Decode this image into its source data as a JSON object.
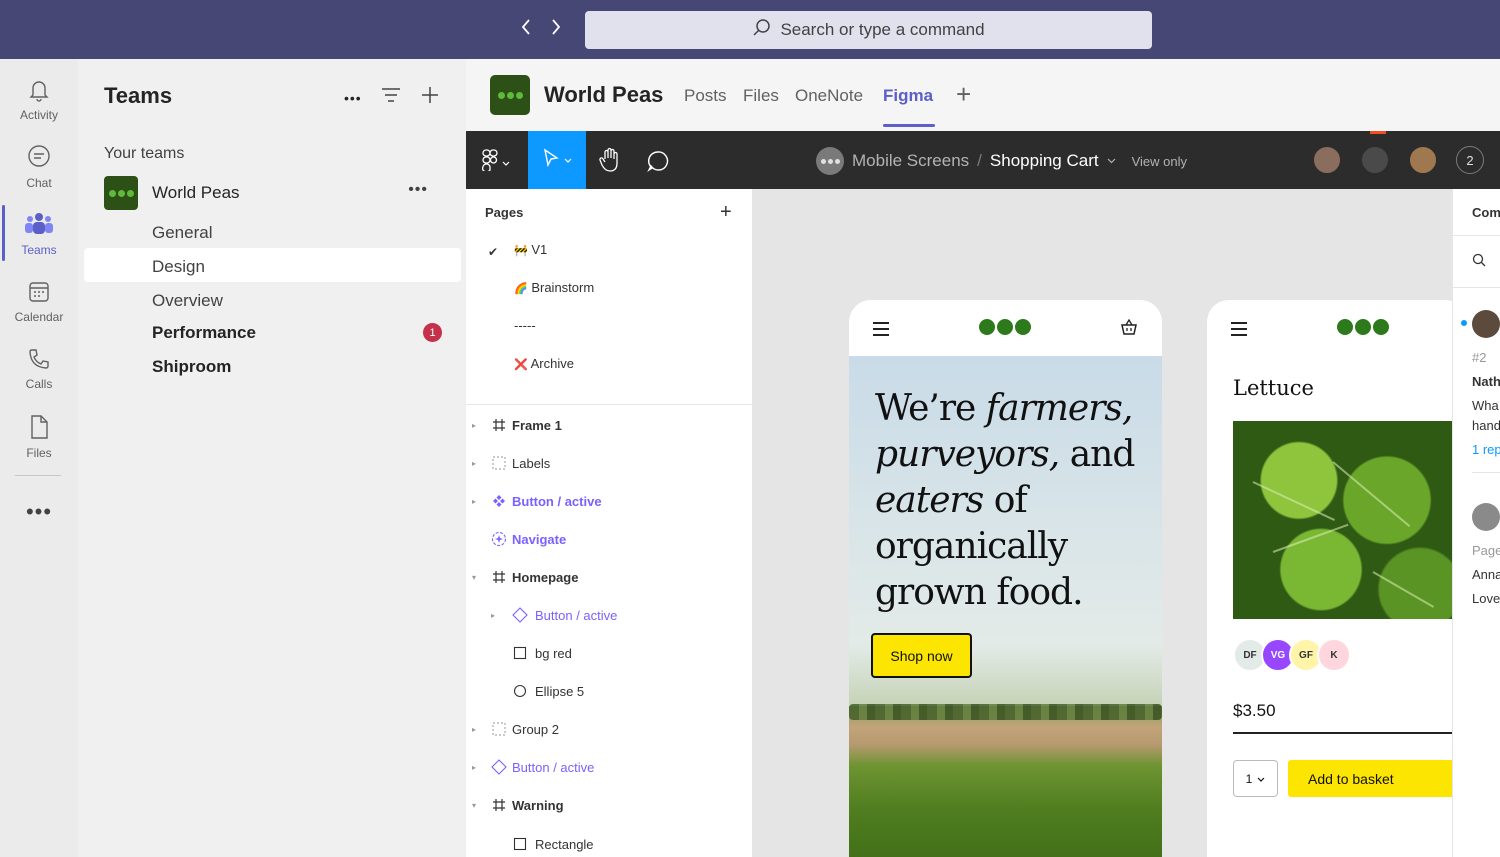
{
  "topbar": {
    "back_icon": "chevron-left-icon",
    "forward_icon": "chevron-right-icon",
    "search_placeholder": "Search or type a command",
    "color": "#464775"
  },
  "rail": {
    "items": [
      {
        "label": "Activity",
        "icon": "bell-icon"
      },
      {
        "label": "Chat",
        "icon": "chat-icon"
      },
      {
        "label": "Teams",
        "icon": "teams-icon",
        "active": true
      },
      {
        "label": "Calendar",
        "icon": "calendar-icon"
      },
      {
        "label": "Calls",
        "icon": "phone-icon"
      },
      {
        "label": "Files",
        "icon": "file-icon"
      }
    ],
    "more": "•••"
  },
  "teams_panel": {
    "title": "Teams",
    "more": "•••",
    "section": "Your teams",
    "team_name": "World Peas",
    "team_more": "•••",
    "channels": [
      "General",
      "Design",
      "Overview",
      "Performance",
      "Shiproom"
    ],
    "badge": "1"
  },
  "channel_header": {
    "title": "World Peas",
    "tabs": [
      "Posts",
      "Files",
      "OneNote",
      "Figma"
    ],
    "active_tab": "Figma",
    "add": "+"
  },
  "figma_toolbar": {
    "project": "Mobile Screens",
    "separator": "/",
    "file": "Shopping Cart",
    "view_mode": "View only",
    "collaborator_count": "2",
    "accent": "#0d99ff"
  },
  "pages_panel": {
    "title": "Pages",
    "add": "+",
    "check": "✔",
    "pages": [
      {
        "emoji": "🚧",
        "name": "V1"
      },
      {
        "emoji": "🌈",
        "name": "Brainstorm"
      },
      {
        "emoji": "",
        "name": "-----"
      },
      {
        "emoji": "❌",
        "name": "Archive"
      }
    ],
    "layers": [
      {
        "name": "Frame 1",
        "icon": "frame-icon",
        "caret": "▸"
      },
      {
        "name": "Labels",
        "icon": "section-icon",
        "caret": "▸"
      },
      {
        "name": "Button / active",
        "icon": "component-icon",
        "caret": "▸"
      },
      {
        "name": "Navigate",
        "icon": "instance-icon",
        "caret": ""
      },
      {
        "name": "Homepage",
        "icon": "frame-icon",
        "caret": "▾"
      },
      {
        "name": "Button / active",
        "icon": "instance-diamond-icon",
        "caret": "▸"
      },
      {
        "name": "bg red",
        "icon": "rectangle-icon",
        "caret": ""
      },
      {
        "name": "Ellipse 5",
        "icon": "ellipse-icon",
        "caret": ""
      },
      {
        "name": "Group 2",
        "icon": "section-icon",
        "caret": "▸"
      },
      {
        "name": "Button / active",
        "icon": "instance-diamond-icon",
        "caret": "▸"
      },
      {
        "name": "Warning",
        "icon": "frame-icon",
        "caret": "▾"
      },
      {
        "name": "Rectangle",
        "icon": "rectangle-icon",
        "caret": ""
      }
    ]
  },
  "canvas": {
    "home": {
      "headline_1": "We’re",
      "headline_2": "farmers,",
      "headline_3": "purveyors,",
      "headline_4": "and",
      "headline_5": "eaters",
      "headline_6": "of organically grown food.",
      "cta": "Shop now"
    },
    "product": {
      "title": "Lettuce",
      "initials": [
        "DF",
        "VG",
        "GF",
        "K"
      ],
      "price": "$3.50",
      "qty": "1",
      "add_button": "Add to basket"
    },
    "brand_color": "#2d7a1d",
    "button_color": "#fce500"
  },
  "comments_panel": {
    "title": "Com",
    "number": "#2",
    "author": "Nath",
    "line1": "Wha",
    "line2": "hand",
    "replies": "1 rep",
    "page": "Page",
    "author2": "Anna",
    "line3": "Love"
  }
}
